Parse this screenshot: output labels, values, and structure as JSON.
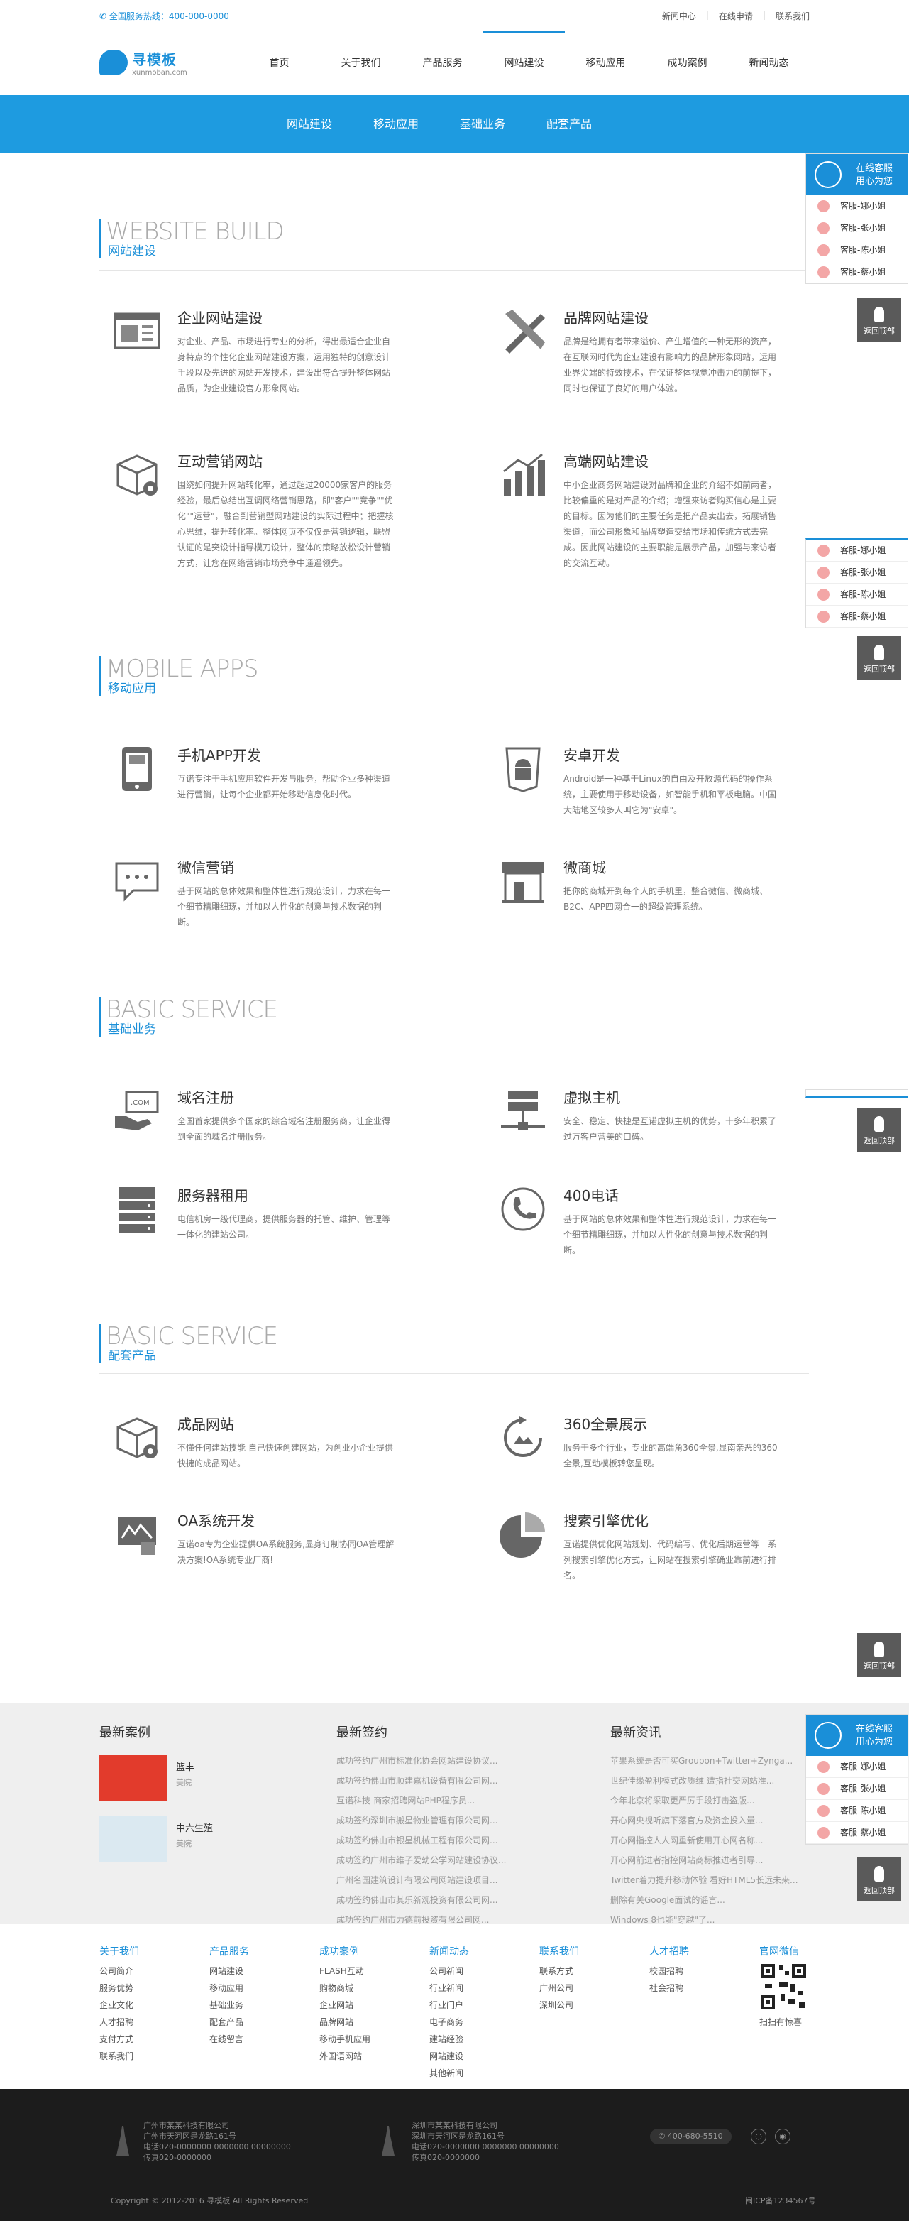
{
  "topbar": {
    "hotline": "全国服务热线：400-000-0000",
    "links": [
      "新闻中心",
      "在线申请",
      "联系我们"
    ]
  },
  "logo": {
    "name": "寻模板",
    "domain": "xunmoban.com"
  },
  "nav": [
    "首页",
    "关于我们",
    "产品服务",
    "网站建设",
    "移动应用",
    "成功案例",
    "新闻动态"
  ],
  "subnav": [
    "网站建设",
    "移动应用",
    "基础业务",
    "配套产品"
  ],
  "sections": [
    {
      "en": "WEBSITE BUILD",
      "cn": "网站建设",
      "items": [
        {
          "title": "企业网站建设",
          "icon": "browser-icon",
          "desc": "对企业、产品、市场进行专业的分析，得出最适合企业自身特点的个性化企业网站建设方案，运用独特的创意设计手段以及先进的网站开发技术，建设出符合提升整体网站品质，为企业建设官方形象网站。"
        },
        {
          "title": "品牌网站建设",
          "icon": "pencil-ruler-icon",
          "desc": "品牌是给拥有者带来溢价、产生增值的一种无形的资产，在互联网时代为企业建设有影响力的品牌形象网站，运用业界尖端的特效技术，在保证整体视觉冲击力的前提下，同时也保证了良好的用户体验。"
        },
        {
          "title": "互动营销网站",
          "icon": "box-gear-icon",
          "desc": "围绕如何提升网站转化率，通过超过20000家客户的服务经验，最后总结出互调网络营销思路，即\"客户\"\"竞争\"\"优化\"\"运营\"，融合到营销型网站建设的实际过程中；把握核心思维，提升转化率。整体网页不仅仅是营销逻辑，联盟认证的是突设计指导模刀设计，整体的策略放松设计营销方式，让您在网络营销市场竞争中遥遥领先。"
        },
        {
          "title": "高端网站建设",
          "icon": "bar-chart-icon",
          "desc": "中小企业商务网站建设对品牌和企业的介绍不如前两者，比较偏重的是对产品的介绍；增强来访者购买信心是主要的目标。因为他们的主要任务是把产品卖出去，拓展销售渠道，而公司形象和品牌塑造交给市场和传统方式去完成。因此网站建设的主要职能是展示产品，加强与来访者的交流互动。"
        }
      ]
    },
    {
      "en": "MOBILE APPS",
      "cn": "移动应用",
      "items": [
        {
          "title": "手机APP开发",
          "icon": "tablet-icon",
          "desc": "互诺专注于手机应用软件开发与服务，帮助企业多种渠道进行营销，让每个企业都开始移动信息化时代。"
        },
        {
          "title": "安卓开发",
          "icon": "android-icon",
          "desc": "Android是一种基于Linux的自由及开放源代码的操作系统，主要使用于移动设备，如智能手机和平板电脑。中国大陆地区较多人叫它为\"安卓\"。"
        },
        {
          "title": "微信营销",
          "icon": "chat-icon",
          "desc": "基于网站的总体效果和整体性进行规范设计，力求在每一个细节精雕细琢，并加以人性化的创意与技术数据的判断。"
        },
        {
          "title": "微商城",
          "icon": "shop-icon",
          "desc": "把你的商城开到每个人的手机里，整合微信、微商城、B2C、APP四网合一的超级管理系统。"
        }
      ]
    },
    {
      "en": "BASIC SERVICE",
      "cn": "基础业务",
      "items": [
        {
          "title": "域名注册",
          "icon": "domain-hand-icon",
          "desc": "全国首家提供多个国家的综合域名注册服务商，让企业得到全面的域名注册服务。"
        },
        {
          "title": "虚拟主机",
          "icon": "server-network-icon",
          "desc": "安全、稳定、快捷是互诺虚拟主机的优势，十多年积累了过万客户营美的口碑。"
        },
        {
          "title": "服务器租用",
          "icon": "server-rack-icon",
          "desc": "电信机房一级代理商，提供服务器的托管、维护、管理等一体化的建站公司。"
        },
        {
          "title": "400电话",
          "icon": "phone-icon",
          "desc": "基于网站的总体效果和整体性进行规范设计，力求在每一个细节精雕细琢，并加以人性化的创意与技术数据的判断。"
        }
      ]
    },
    {
      "en": "BASIC SERVICE",
      "cn": "配套产品",
      "items": [
        {
          "title": "成品网站",
          "icon": "box-gear-icon",
          "desc": "不懂任何建站技能 自己快速创建网站，为创业小企业提供快捷的成品网站。"
        },
        {
          "title": "360全景展示",
          "icon": "panorama-icon",
          "desc": "服务于多个行业，专业的高端角360全景,显南亲恶的360全景,互动模板转您呈现。"
        },
        {
          "title": "OA系统开发",
          "icon": "oa-icon",
          "desc": "互诺oa专为企业提供OA系统服务,显身订制协同OA管理解决方案!OA系统专业厂商!"
        },
        {
          "title": "搜索引擎优化",
          "icon": "pie-chart-icon",
          "desc": "互诺提供优化网站规划、代码编写、优化后期运营等一系列搜索引擎优化方式，让网站在搜索引擎确业靠前进行排名。"
        }
      ]
    }
  ],
  "float": {
    "title1": "在线客服",
    "title2": "用心为您",
    "staff": [
      "客服-娜小姐",
      "客服-张小姐",
      "客服-陈小姐",
      "客服-蔡小姐"
    ],
    "backtop": "返回顶部"
  },
  "news": {
    "cases": {
      "title": "最新案例",
      "items": [
        {
          "name": "篮丰",
          "sub": "美院"
        },
        {
          "name": "中六生殖",
          "sub": "美院"
        }
      ]
    },
    "signing": {
      "title": "最新签约",
      "items": [
        "成功签约广州市标准化协会网站建设协议...",
        "成功签约佛山市顺建嘉机设备有限公司网...",
        "互诺科技-商家招聘网站PHP程序员...",
        "成功签约深圳市搬星物业管理有限公司网...",
        "成功签约佛山市银星机械工程有限公司网...",
        "成功签约广州市维子爱幼公学网站建设协议...",
        "广州名园建筑设计有限公司网站建设项目...",
        "成功签约佛山市其乐新观投资有限公司网...",
        "成功签约广州市力德前投资有限公司网..."
      ]
    },
    "info": {
      "title": "最新资讯",
      "items": [
        "苹果系统是否可买Groupon+Twitter+Zynga...",
        "世纪佳缘盈利模式改质维 遭指社交网站准...",
        "今年北京将采取更严厉手段打击盗版...",
        "开心网央视听旗下落官方及资金投入量...",
        "开心网指控人人网重新使用开心网名称...",
        "开心网前进者指控网站商标推进者引导...",
        "Twitter着力提升移动体验 看好HTML5长远未来...",
        "删除有关Google面试的谣言...",
        "Windows 8也能\"穿越\"了..."
      ]
    }
  },
  "footer_links": [
    {
      "title": "关于我们",
      "items": [
        "公司简介",
        "服务优势",
        "企业文化",
        "人才招聘",
        "支付方式",
        "联系我们"
      ]
    },
    {
      "title": "产品服务",
      "items": [
        "网站建设",
        "移动应用",
        "基础业务",
        "配套产品",
        "在线留言"
      ]
    },
    {
      "title": "成功案例",
      "items": [
        "FLASH互动",
        "购物商城",
        "企业网站",
        "品牌网站",
        "移动手机应用",
        "外国语网站"
      ]
    },
    {
      "title": "新闻动态",
      "items": [
        "公司新闻",
        "行业新闻",
        "行业门户",
        "电子商务",
        "建站经验",
        "网站建设",
        "其他新闻"
      ]
    },
    {
      "title": "联系我们",
      "items": [
        "联系方式",
        "广州公司",
        "深圳公司"
      ]
    },
    {
      "title": "人才招聘",
      "items": [
        "校园招聘",
        "社会招聘"
      ]
    },
    {
      "title": "官网微信",
      "items": [
        "扫扫有惊喜"
      ]
    }
  ],
  "footer": {
    "office1": [
      "广州市某某科技有限公司",
      "广州市天河区是龙路161号",
      "电话020-0000000 0000000 00000000",
      "传真020-0000000"
    ],
    "office2": [
      "深圳市某某科技有限公司",
      "深圳市天河区是龙路161号",
      "电话020-0000000 0000000 00000000",
      "传真020-0000000"
    ],
    "phone": "400-680-5510",
    "copyright": "Copyright © 2012-2016 寻模板 All Rights Reserved",
    "icp": "闽ICP备1234567号"
  }
}
